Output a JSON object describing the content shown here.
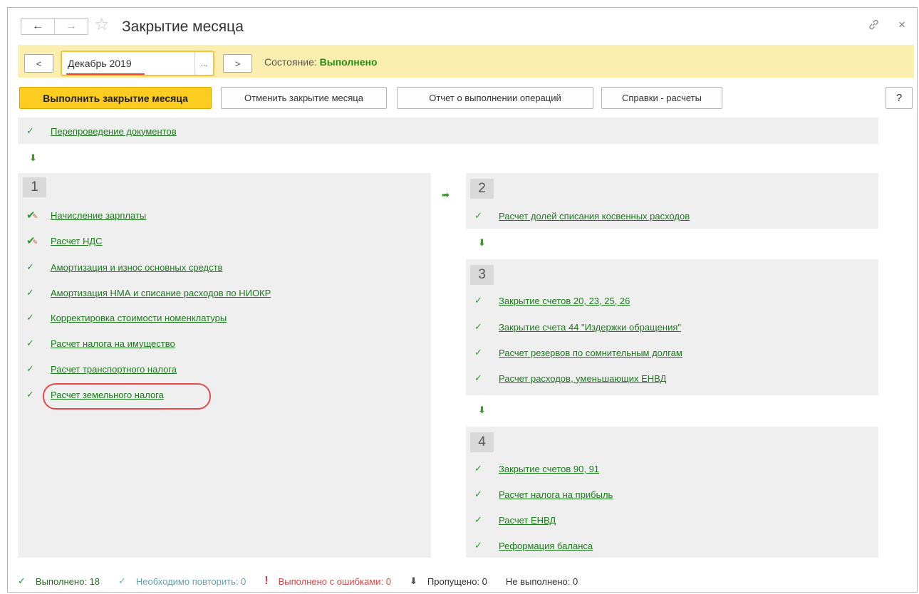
{
  "window": {
    "title": "Закрытие месяца",
    "icons": {
      "back": "arrow-left-icon",
      "forward": "arrow-right-icon",
      "favorite": "star-icon",
      "link": "link-icon",
      "close": "close-icon"
    },
    "nav_back": "←",
    "nav_forward": "→",
    "close_glyph": "×"
  },
  "period": {
    "prev_label": "<",
    "next_label": ">",
    "value": "Декабрь 2019",
    "select_label": "...",
    "state_label": "Состояние:",
    "state_value": "Выполнено"
  },
  "toolbar": {
    "run_label": "Выполнить закрытие месяца",
    "cancel_label": "Отменить закрытие месяца",
    "report_label": "Отчет о выполнении операций",
    "refs_label": "Справки - расчеты",
    "help_label": "?"
  },
  "reposting": {
    "label": "Перепроведение документов"
  },
  "stage1": {
    "number": "1",
    "items": [
      {
        "label": "Начисление зарплаты",
        "status": "done-edited"
      },
      {
        "label": "Расчет НДС",
        "status": "done-edited"
      },
      {
        "label": "Амортизация и износ основных средств",
        "status": "done"
      },
      {
        "label": "Амортизация НМА и списание расходов по НИОКР",
        "status": "done"
      },
      {
        "label": "Корректировка стоимости номенклатуры",
        "status": "done"
      },
      {
        "label": "Расчет налога на имущество",
        "status": "done"
      },
      {
        "label": "Расчет транспортного налога",
        "status": "done"
      },
      {
        "label": "Расчет земельного налога",
        "status": "done"
      }
    ]
  },
  "stage2": {
    "number": "2",
    "items": [
      {
        "label": "Расчет долей списания косвенных расходов",
        "status": "done"
      }
    ]
  },
  "stage3": {
    "number": "3",
    "items": [
      {
        "label": "Закрытие счетов 20, 23, 25, 26",
        "status": "done"
      },
      {
        "label": "Закрытие счета 44 \"Издержки обращения\"",
        "status": "done"
      },
      {
        "label": "Расчет резервов по сомнительным долгам",
        "status": "done"
      },
      {
        "label": "Расчет расходов, уменьшающих ЕНВД",
        "status": "done"
      }
    ]
  },
  "stage4": {
    "number": "4",
    "items": [
      {
        "label": "Закрытие счетов 90, 91",
        "status": "done"
      },
      {
        "label": "Расчет налога на прибыль",
        "status": "done"
      },
      {
        "label": "Расчет ЕНВД",
        "status": "done"
      },
      {
        "label": "Реформация баланса",
        "status": "done"
      }
    ]
  },
  "status_bar": {
    "done": "Выполнено: 18",
    "repeat": "Необходимо повторить: 0",
    "errors": "Выполнено с ошибками: 0",
    "skipped": "Пропущено: 0",
    "not_done": "Не выполнено: 0"
  },
  "colors": {
    "accent": "#fccc21",
    "link": "#1c7a1c",
    "check": "#2d9a2d",
    "error": "#e03a3a",
    "period_bar": "#fbeeae"
  }
}
